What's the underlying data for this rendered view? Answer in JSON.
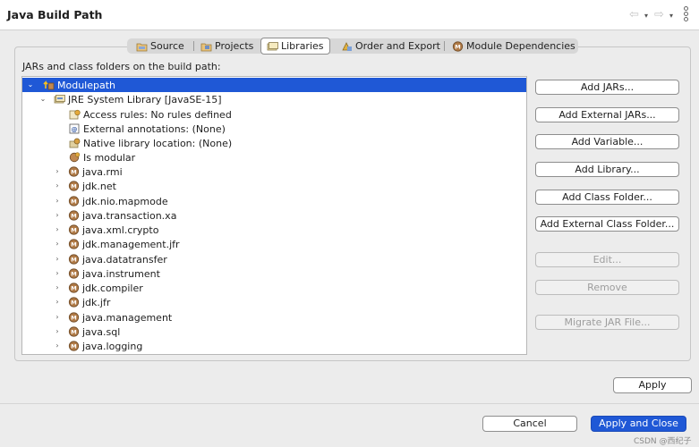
{
  "window": {
    "title": "Java Build Path"
  },
  "header_nav": {
    "back_icon": "⇦",
    "forward_icon": "⇨",
    "dropdown_icon": "▾"
  },
  "tabs": [
    {
      "label": "Source",
      "icon": "source-folder-icon",
      "active": false
    },
    {
      "label": "Projects",
      "icon": "projects-folder-icon",
      "active": false
    },
    {
      "label": "Libraries",
      "icon": "libraries-icon",
      "active": true
    },
    {
      "label": "Order and Export",
      "icon": "order-export-icon",
      "active": false
    },
    {
      "label": "Module Dependencies",
      "icon": "module-icon",
      "active": false
    }
  ],
  "libraries": {
    "list_label": "JARs and class folders on the build path:",
    "tree": [
      {
        "label": "Modulepath",
        "expanded": true,
        "twisty": "⌄",
        "icon": "modulepath-icon",
        "selected": true
      },
      {
        "label": "JRE System Library [JavaSE-15]",
        "expanded": true,
        "twisty": "⌄",
        "icon": "jre-library-icon"
      },
      {
        "label": "Access rules: No rules defined",
        "icon": "access-rules-icon"
      },
      {
        "label": "External annotations: (None)",
        "icon": "annotations-icon"
      },
      {
        "label": "Native library location: (None)",
        "icon": "native-library-icon"
      },
      {
        "label": "Is modular",
        "icon": "modular-icon"
      },
      {
        "label": "java.rmi",
        "twisty": "›",
        "icon": "module-icon"
      },
      {
        "label": "jdk.net",
        "twisty": "›",
        "icon": "module-icon"
      },
      {
        "label": "jdk.nio.mapmode",
        "twisty": "›",
        "icon": "module-icon"
      },
      {
        "label": "java.transaction.xa",
        "twisty": "›",
        "icon": "module-icon"
      },
      {
        "label": "java.xml.crypto",
        "twisty": "›",
        "icon": "module-icon"
      },
      {
        "label": "jdk.management.jfr",
        "twisty": "›",
        "icon": "module-icon"
      },
      {
        "label": "java.datatransfer",
        "twisty": "›",
        "icon": "module-icon"
      },
      {
        "label": "java.instrument",
        "twisty": "›",
        "icon": "module-icon"
      },
      {
        "label": "jdk.compiler",
        "twisty": "›",
        "icon": "module-icon"
      },
      {
        "label": "jdk.jfr",
        "twisty": "›",
        "icon": "module-icon"
      },
      {
        "label": "java.management",
        "twisty": "›",
        "icon": "module-icon"
      },
      {
        "label": "java.sql",
        "twisty": "›",
        "icon": "module-icon"
      },
      {
        "label": "java.logging",
        "twisty": "›",
        "icon": "module-icon"
      }
    ],
    "buttons": [
      {
        "label": "Add JARs...",
        "enabled": true
      },
      {
        "label": "Add External JARs...",
        "enabled": true
      },
      {
        "label": "Add Variable...",
        "enabled": true
      },
      {
        "label": "Add Library...",
        "enabled": true
      },
      {
        "label": "Add Class Folder...",
        "enabled": true
      },
      {
        "label": "Add External Class Folder...",
        "enabled": true
      },
      {
        "label": "Edit...",
        "enabled": false
      },
      {
        "label": "Remove",
        "enabled": false
      },
      {
        "label": "Migrate JAR File...",
        "enabled": false
      }
    ]
  },
  "footer": {
    "apply_label": "Apply",
    "cancel_label": "Cancel",
    "apply_close_label": "Apply and Close",
    "watermark": "CSDN @西纪子"
  },
  "colors": {
    "selection": "#1f58d6",
    "module_icon": "#9a6a3a",
    "primary_button": "#1f58d6"
  }
}
